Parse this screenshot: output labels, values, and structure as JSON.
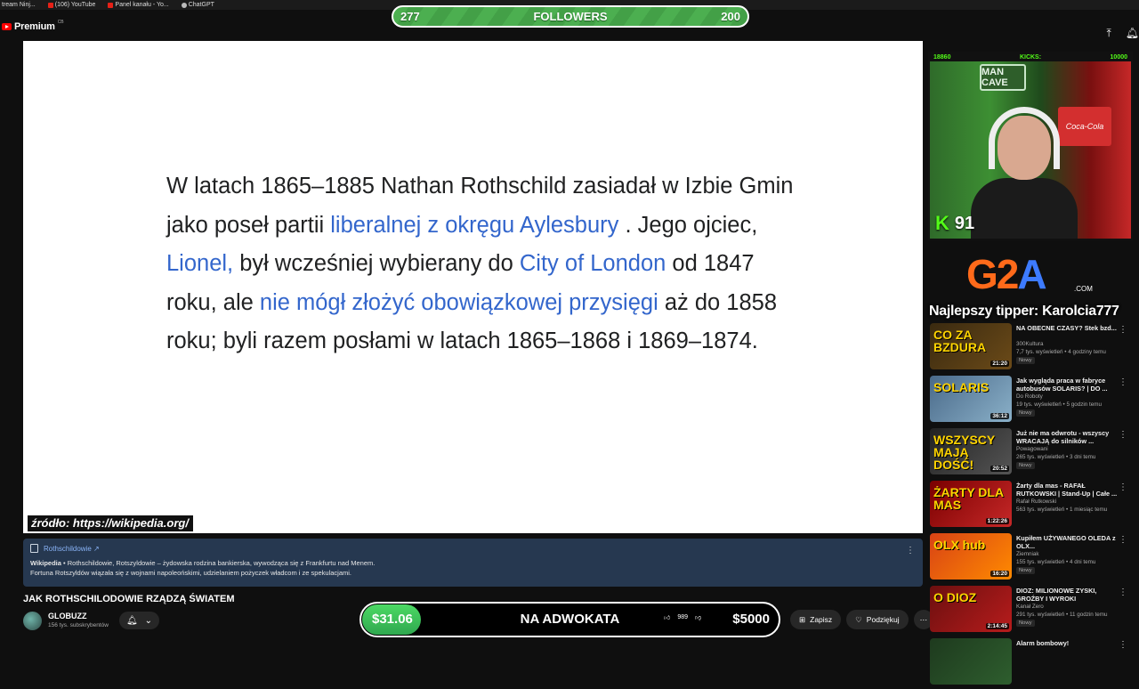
{
  "bookmarks": [
    {
      "label": "tream Ninj..."
    },
    {
      "label": "(106) YouTube"
    },
    {
      "label": "Panel kanału - Yo..."
    },
    {
      "label": "ChatGPT"
    }
  ],
  "header": {
    "logo_text": "Premium",
    "country_code": "CB"
  },
  "followers_bar": {
    "current": "277",
    "label": "FOLLOWERS",
    "goal": "200"
  },
  "video": {
    "paragraph": {
      "p1": "W latach 1865–1885 Nathan Rothschild zasiadał w Izbie Gmin jako poseł partii ",
      "l1": "liberalnej z okręgu Aylesbury",
      "p2": " . Jego ojciec, ",
      "l2": "Lionel,",
      "p3": " był wcześniej wybierany do ",
      "l3": "City of London",
      "p4": " od 1847 roku, ale ",
      "l4": "nie mógł złożyć obowiązkowej przysięgi",
      "p5": " aż do 1858 roku; byli razem posłami w latach 1865–1868 i 1869–1874."
    },
    "source_label": "źródło: https://wikipedia.org/"
  },
  "info_panel": {
    "link": "Rothschildowie ↗",
    "source": "Wikipedia",
    "desc1": " • Rothschildowie, Rotszyldowie – żydowska rodzina bankierska, wywodząca się z Frankfurtu nad Menem.",
    "desc2": "Fortuna Rotszyldów wiązała się z wojnami napoleońskimi, udzielaniem pożyczek władcom i ze spekulacjami."
  },
  "video_title": "JAK ROTHSCHILODOWIE RZĄDZĄ ŚWIATEM",
  "channel": {
    "name": "GLOBUZZ",
    "subs": "156 tys. subskrybentów"
  },
  "donation_goal": {
    "current": "$31.06",
    "title": "NA ADWOKATA",
    "goal": "$5000",
    "progress_fraction": 0.0062,
    "likes": "989"
  },
  "actions": {
    "save": "Zapisz",
    "thanks": "Podziękuj"
  },
  "stream": {
    "kick_left": "18860",
    "kick_label": "KICKS:",
    "kick_right": "10000",
    "viewers": "91",
    "sign_text": "MAN CAVE",
    "coke_text": "Coca-Cola",
    "sponsor": {
      "g": "G",
      "two": "2",
      "a": "A",
      "com": ".COM"
    },
    "top_tipper": "Najlepszy tipper: Karolcia777"
  },
  "recommendations": [
    {
      "title": "NA OBECNE CZASY? Stek bzd...",
      "channel": "300Kultura",
      "meta": "7,7 tys. wyświetleń • 4 godziny temu",
      "badge": "Nowy",
      "duration": "21:20",
      "thumb_text": "CO ZA BZDURA",
      "colors": [
        "#3a2a10",
        "#6b4a18"
      ]
    },
    {
      "title": "Jak wygląda praca w fabryce autobusów SOLARIS? | DO ...",
      "channel": "Do Roboty",
      "meta": "19 tys. wyświetleń • 5 godzin temu",
      "badge": "Nowy",
      "duration": "36:12",
      "thumb_text": "SOLARIS",
      "colors": [
        "#4a6a8a",
        "#8ab0c8"
      ]
    },
    {
      "title": "Już nie ma odwrotu - wszyscy WRACAJĄ do silników ...",
      "channel": "Powagowani",
      "meta": "265 tys. wyświetleń • 3 dni temu",
      "badge": "Nowy",
      "duration": "20:52",
      "thumb_text": "WSZYSCY MAJĄ DOŚĆ!",
      "colors": [
        "#222",
        "#555"
      ]
    },
    {
      "title": "Żarty dla mas - RAFAŁ RUTKOWSKI | Stand-Up | Całe ...",
      "channel": "Rafał Rutkowski",
      "meta": "563 tys. wyświetleń • 1 miesiąc temu",
      "badge": "",
      "duration": "1:22:26",
      "thumb_text": "ŻARTY DLA MAS",
      "colors": [
        "#7a0000",
        "#c62828"
      ]
    },
    {
      "title": "Kupiłem UŻYWANEGO OLEDA z OLX...",
      "channel": "Ziemniak",
      "meta": "155 tys. wyświetleń • 4 dni temu",
      "badge": "Nowy",
      "duration": "16:20",
      "thumb_text": "OLX hub",
      "colors": [
        "#d84315",
        "#ff8a00"
      ]
    },
    {
      "title": "DIOZ: MILIONOWE ZYSKI, GROŹBY I WYROKI",
      "channel": "Kanał Zero",
      "meta": "291 tys. wyświetleń • 11 godzin temu",
      "badge": "Nowy",
      "duration": "2:14:45",
      "thumb_text": "O DIOZ",
      "colors": [
        "#6b0f0f",
        "#b71c1c"
      ]
    },
    {
      "title": "Alarm bombowy!",
      "channel": "",
      "meta": "",
      "badge": "",
      "duration": "",
      "thumb_text": "",
      "colors": [
        "#1e3a1e",
        "#2e5e2e"
      ]
    }
  ]
}
